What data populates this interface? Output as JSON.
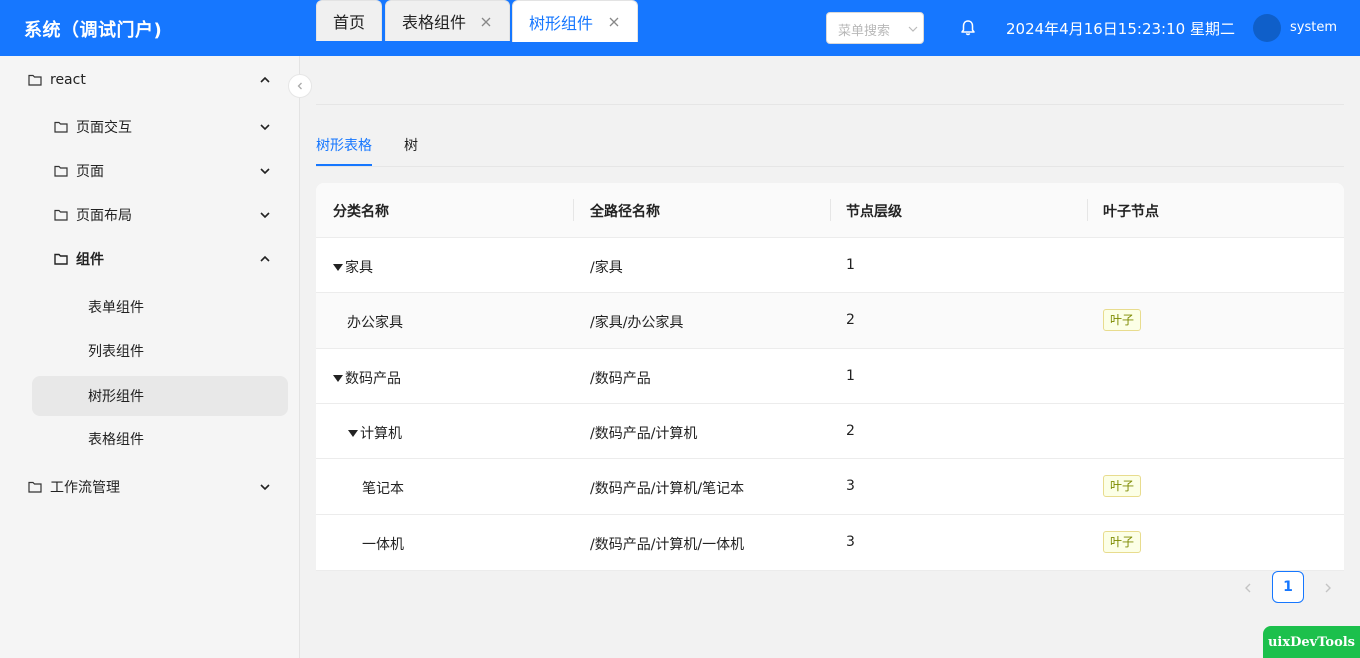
{
  "header": {
    "title": "系统（调试门户)",
    "search_placeholder": "菜单搜索",
    "datetime": "2024年4月16日15:23:10 星期二",
    "username": "system"
  },
  "sidebar": {
    "items": [
      {
        "label": "react"
      },
      {
        "label": "页面交互"
      },
      {
        "label": "页面"
      },
      {
        "label": "页面布局"
      },
      {
        "label": "组件"
      },
      {
        "label": "表单组件"
      },
      {
        "label": "列表组件"
      },
      {
        "label": "树形组件"
      },
      {
        "label": "表格组件"
      },
      {
        "label": "工作流管理"
      }
    ]
  },
  "tabs": [
    {
      "label": "首页"
    },
    {
      "label": "表格组件"
    },
    {
      "label": "树形组件"
    }
  ],
  "subtabs": [
    {
      "label": "树形表格"
    },
    {
      "label": "树"
    }
  ],
  "table": {
    "columns": [
      "分类名称",
      "全路径名称",
      "节点层级",
      "叶子节点"
    ],
    "rows": [
      {
        "name": "家具",
        "path": "/家具",
        "level": "1",
        "leaf": ""
      },
      {
        "name": "办公家具",
        "path": "/家具/办公家具",
        "level": "2",
        "leaf": "叶子"
      },
      {
        "name": "数码产品",
        "path": "/数码产品",
        "level": "1",
        "leaf": ""
      },
      {
        "name": "计算机",
        "path": "/数码产品/计算机",
        "level": "2",
        "leaf": ""
      },
      {
        "name": "笔记本",
        "path": "/数码产品/计算机/笔记本",
        "level": "3",
        "leaf": "叶子"
      },
      {
        "name": "一体机",
        "path": "/数码产品/计算机/一体机",
        "level": "3",
        "leaf": "叶子"
      }
    ]
  },
  "pagination": {
    "current": "1"
  },
  "devtools": {
    "label": "uixDevTools"
  },
  "colors": {
    "primary": "#1677ff",
    "devtools": "#1cc04c",
    "leaf_tag": "#7c8a00"
  }
}
